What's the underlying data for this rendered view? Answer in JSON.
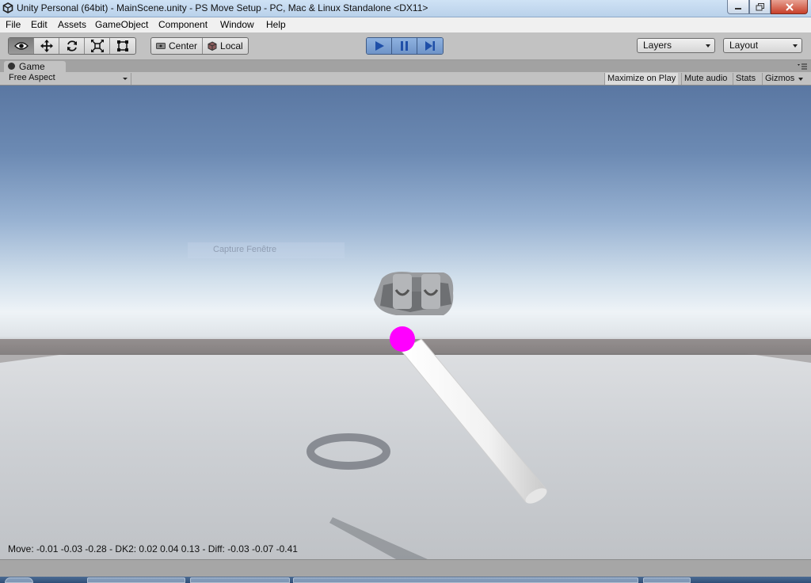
{
  "window": {
    "title": "Unity Personal (64bit) - MainScene.unity - PS Move Setup - PC, Mac & Linux Standalone <DX11>"
  },
  "menu": [
    "File",
    "Edit",
    "Assets",
    "GameObject",
    "Component",
    "Window",
    "Help"
  ],
  "toolbar": {
    "tools": [
      "hand-tool",
      "move-tool",
      "rotate-tool",
      "scale-tool",
      "rect-tool"
    ],
    "pivot": "Center",
    "space": "Local",
    "layers": "Layers",
    "layout": "Layout",
    "play_state": "playing"
  },
  "game_tab": {
    "label": "Game",
    "aspect": "Free Aspect",
    "maximize_on_play": "Maximize on Play",
    "mute_audio": "Mute audio",
    "stats": "Stats",
    "gizmos": "Gizmos"
  },
  "viewport": {
    "overlay_text": "Capture Fenêtre",
    "debug_line": "Move: -0.01 -0.03 -0.28 - DK2: 0.02 0.04 0.13 - Diff: -0.03 -0.07 -0.41",
    "colors": {
      "sky_top": "#5a77a2",
      "horizon": "#eef3f7",
      "ground": "#cfd2d6",
      "sphere": "#ff00ff",
      "controller": "#f4f4f4"
    }
  }
}
